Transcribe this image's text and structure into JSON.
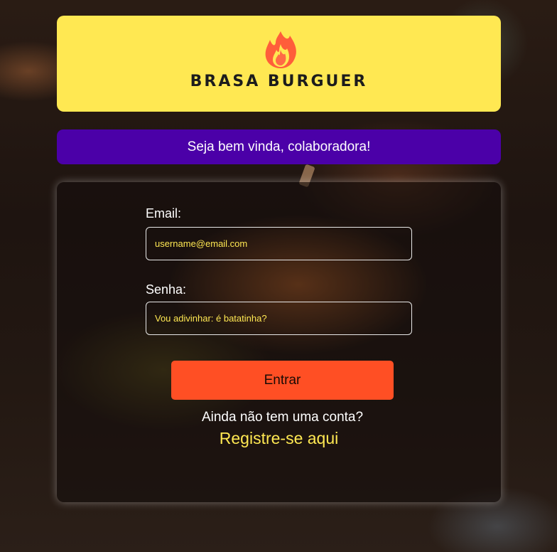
{
  "brand": {
    "name": "BRASA BURGUER",
    "logo_icon": "flame-icon",
    "logo_bg_color": "#ffe852"
  },
  "welcome": {
    "text": "Seja bem vinda, colaboradora!",
    "bg_color": "#4b00a8"
  },
  "login_form": {
    "email_label": "Email:",
    "email_placeholder": "username@email.com",
    "password_label": "Senha:",
    "password_placeholder": "Vou adivinhar: é batatinha?",
    "submit_label": "Entrar",
    "submit_color": "#ff4f24",
    "no_account_text": "Ainda não tem uma conta?",
    "register_link": "Registre-se aqui",
    "accent_color": "#ffe852"
  }
}
